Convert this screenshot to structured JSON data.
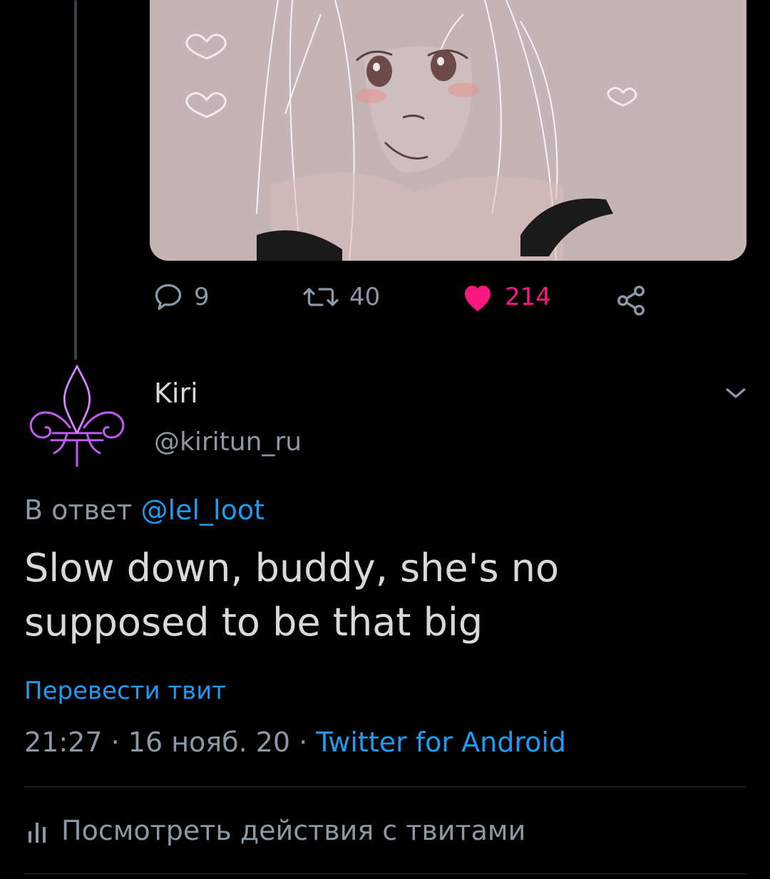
{
  "stats": {
    "replies": "9",
    "retweets": "40",
    "likes": "214"
  },
  "author": {
    "name": "Kiri",
    "handle": "@kiritun_ru"
  },
  "reply_to": {
    "prefix": "В ответ",
    "mention": "@lel_loot"
  },
  "tweet": {
    "text": "Slow down, buddy, she's no supposed to be that big"
  },
  "translate": {
    "label": "Перевести твит"
  },
  "meta": {
    "time": "21:27",
    "sep1": " · ",
    "date": "16 нояб. 20",
    "sep2": " · ",
    "source": "Twitter for Android"
  },
  "analytics": {
    "label": "Посмотреть действия с твитами"
  },
  "colors": {
    "background": "#000000",
    "accent": "#1d9bf0",
    "like": "#f91880",
    "muted": "#8b98a5"
  },
  "icons": [
    "reply-icon",
    "retweet-icon",
    "heart-icon",
    "share-icon",
    "chevron-down-icon",
    "analytics-icon"
  ]
}
